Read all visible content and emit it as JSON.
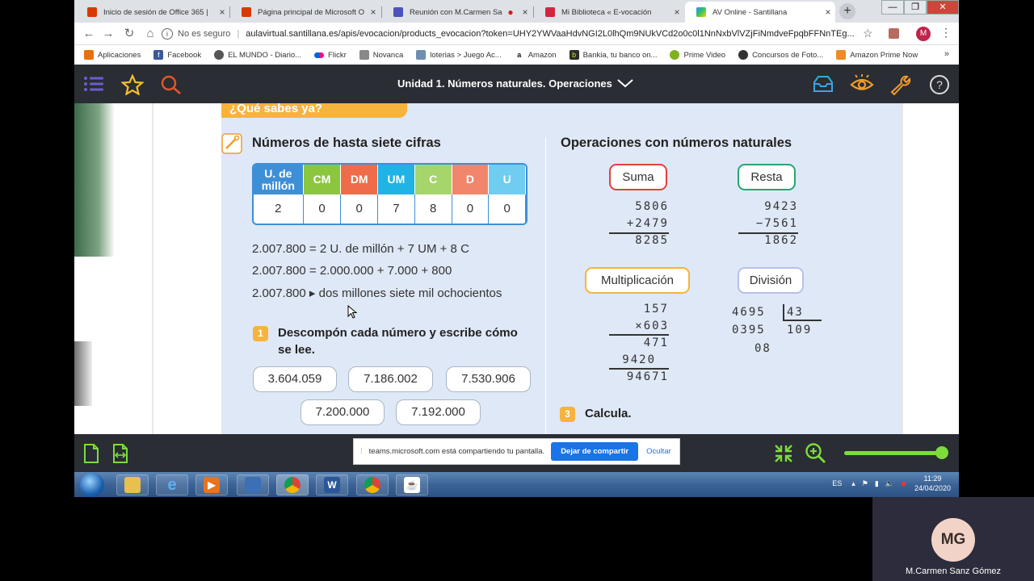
{
  "browser": {
    "tabs": [
      {
        "label": "Inicio de sesión de Office 365 |",
        "color": "#d83b01"
      },
      {
        "label": "Página principal de Microsoft O",
        "color": "#d83b01"
      },
      {
        "label": "Reunión con M.Carmen Sa",
        "color": "#4b53bc"
      },
      {
        "label": "Mi Biblioteca « E-vocación",
        "color": "#d1263d"
      },
      {
        "label": "AV Online - Santillana",
        "color": "#2d8cff"
      }
    ],
    "new_tab": "+",
    "window_controls": [
      "—",
      "❐",
      "✕"
    ],
    "address": {
      "security": "No es seguro",
      "url": "aulavirtual.santillana.es/apis/evocacion/products_evocacion?token=UHY2YWVaaHdvNGI2L0lhQm9NUkVCd2o0c0l1NnNxbVlVZjFiNmdveFpqbFFNnTEg..."
    },
    "profile_initial": "M",
    "bookmarks": [
      {
        "label": "Aplicaciones",
        "icon": "apps-grid-icon",
        "color": "#e8710a"
      },
      {
        "label": "Facebook",
        "icon": "facebook-icon",
        "color": "#3b5998"
      },
      {
        "label": "EL MUNDO - Diario...",
        "icon": "globe-icon",
        "color": "#555555"
      },
      {
        "label": "Flickr",
        "icon": "flickr-icon",
        "color": "#ff0084"
      },
      {
        "label": "Novanca",
        "icon": "novanca-icon",
        "color": "#888888"
      },
      {
        "label": "loterias > Juego Ac...",
        "icon": "lottery-icon",
        "color": "#6f8fb0"
      },
      {
        "label": "Amazon",
        "icon": "amazon-icon",
        "color": "#111111"
      },
      {
        "label": "Bankia, tu banco on...",
        "icon": "bankia-icon",
        "color": "#2c2c2c"
      },
      {
        "label": "Prime Video",
        "icon": "prime-video-icon",
        "color": "#7fb11f"
      },
      {
        "label": "Concursos de Foto...",
        "icon": "camera-icon",
        "color": "#333333"
      },
      {
        "label": "Amazon Prime Now",
        "icon": "prime-now-icon",
        "color": "#f08a24"
      }
    ],
    "bookmarks_more": "»"
  },
  "app": {
    "title": "Unidad 1. Números naturales. Operaciones",
    "share_bar": {
      "text": "teams.microsoft.com está compartiendo tu pantalla.",
      "stop": "Dejar de compartir",
      "hide": "Ocultar"
    },
    "zoom_level": 1.0
  },
  "book": {
    "banner": "¿Qué sabes ya?",
    "left": {
      "heading": "Números de hasta siete cifras",
      "table_headers": [
        "U. de millón",
        "CM",
        "DM",
        "UM",
        "C",
        "D",
        "U"
      ],
      "table_colors": [
        "#3d8fd8",
        "#8cc63f",
        "#ef6c4a",
        "#1fb3e6",
        "#a6d56b",
        "#f2866a",
        "#6fcdf0"
      ],
      "table_values": [
        "2",
        "0",
        "0",
        "7",
        "8",
        "0",
        "0"
      ],
      "equations": [
        "2.007.800 = 2 U. de millón + 7 UM + 8 C",
        "2.007.800 = 2.000.000 + 7.000 + 800",
        "2.007.800 ▸ dos millones siete mil ochocientos"
      ],
      "exercise_num": "1",
      "exercise_text": "Descompón cada número y escribe cómo se lee.",
      "numbers": [
        "3.604.059",
        "7.186.002",
        "7.530.906",
        "7.200.000",
        "7.192.000"
      ]
    },
    "right": {
      "heading": "Operaciones con números naturales",
      "suma": {
        "label": "Suma",
        "lines": [
          "5806",
          "+2479",
          "8285"
        ]
      },
      "resta": {
        "label": "Resta",
        "lines": [
          "9423",
          "−7561",
          "1862"
        ]
      },
      "multiplicacion": {
        "label": "Multiplicación",
        "lines": [
          "157",
          "×603",
          "471",
          "9420",
          "94671"
        ]
      },
      "division": {
        "label": "División",
        "dividend": "4695",
        "divisor": "43",
        "remainder_line": "0395",
        "quotient": "109",
        "remainder": "08"
      },
      "exercise_num": "3",
      "exercise_text": "Calcula."
    }
  },
  "taskbar": {
    "lang": "ES",
    "time": "11:29",
    "date": "24/04/2020"
  },
  "teams_tile": {
    "initials": "MG",
    "name": "M.Carmen Sanz Gómez"
  }
}
